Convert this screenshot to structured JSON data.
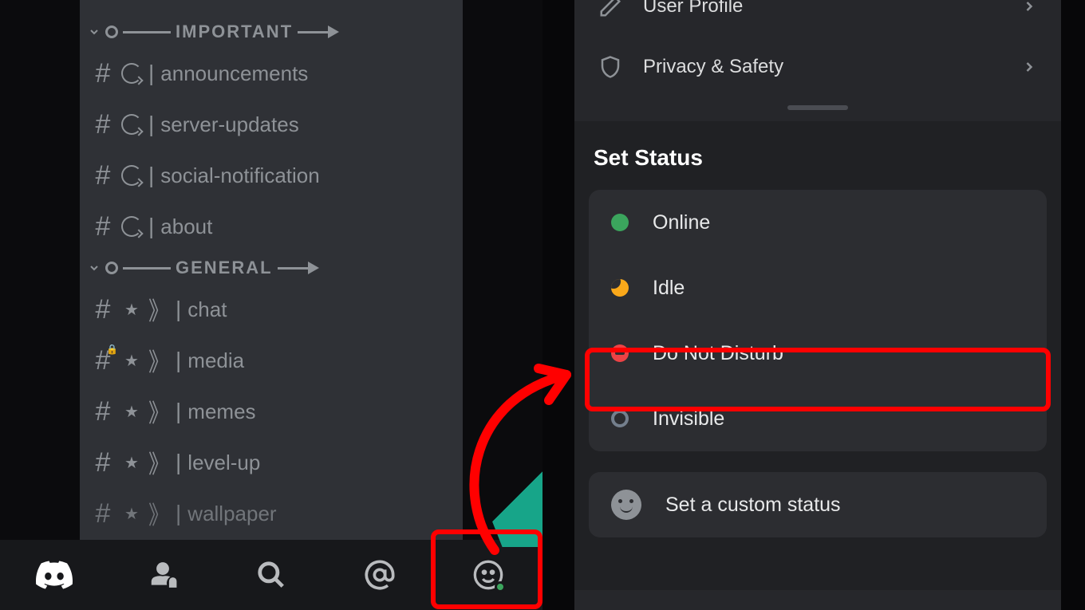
{
  "left": {
    "categories": [
      {
        "name": "IMPORTANT"
      },
      {
        "name": "GENERAL"
      }
    ],
    "channels_important": [
      {
        "name": "announcements"
      },
      {
        "name": "server-updates"
      },
      {
        "name": "social-notification"
      },
      {
        "name": "about"
      }
    ],
    "channels_general": [
      {
        "name": "chat"
      },
      {
        "name": "media"
      },
      {
        "name": "memes"
      },
      {
        "name": "level-up"
      },
      {
        "name": "wallpaper"
      }
    ]
  },
  "right": {
    "settings": [
      {
        "label": "User Profile"
      },
      {
        "label": "Privacy & Safety"
      }
    ],
    "sheet_title": "Set Status",
    "statuses": [
      {
        "label": "Online"
      },
      {
        "label": "Idle"
      },
      {
        "label": "Do Not Disturb"
      },
      {
        "label": "Invisible"
      }
    ],
    "custom_status_label": "Set a custom status"
  }
}
